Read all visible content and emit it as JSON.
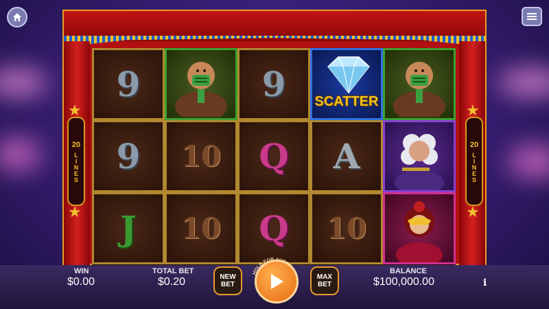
{
  "game": {
    "symbols": [
      [
        "9",
        "",
        "9",
        "",
        ""
      ],
      [
        "9",
        "10",
        "Q",
        "A",
        ""
      ],
      [
        "J",
        "10",
        "Q",
        "10",
        ""
      ]
    ],
    "scatter_label": "SCATTER"
  },
  "lines": {
    "count": "20",
    "word": "LINES"
  },
  "bottom_bar": {
    "win_label": "WIN",
    "win_value": "$0.00",
    "total_bet_label": "TOTAL BET",
    "total_bet_value": "$0.20",
    "new_bet_line1": "NEW",
    "new_bet_line2": "BET",
    "autospin_hint": "HOLD FOR AUTOSPIN",
    "max_bet_line1": "MAX",
    "max_bet_line2": "BET",
    "balance_label": "BALANCE",
    "balance_value": "$100,000.00",
    "info_label": "i"
  },
  "icons": {
    "home": "home-icon",
    "menu": "hamburger-menu-icon",
    "spin": "play-icon",
    "scatter": "diamond-icon"
  },
  "colors": {
    "accent": "#e86a10",
    "frame_gold": "#d49a20",
    "curtain_red": "#c01414",
    "scatter_gold": "#f0c020"
  }
}
